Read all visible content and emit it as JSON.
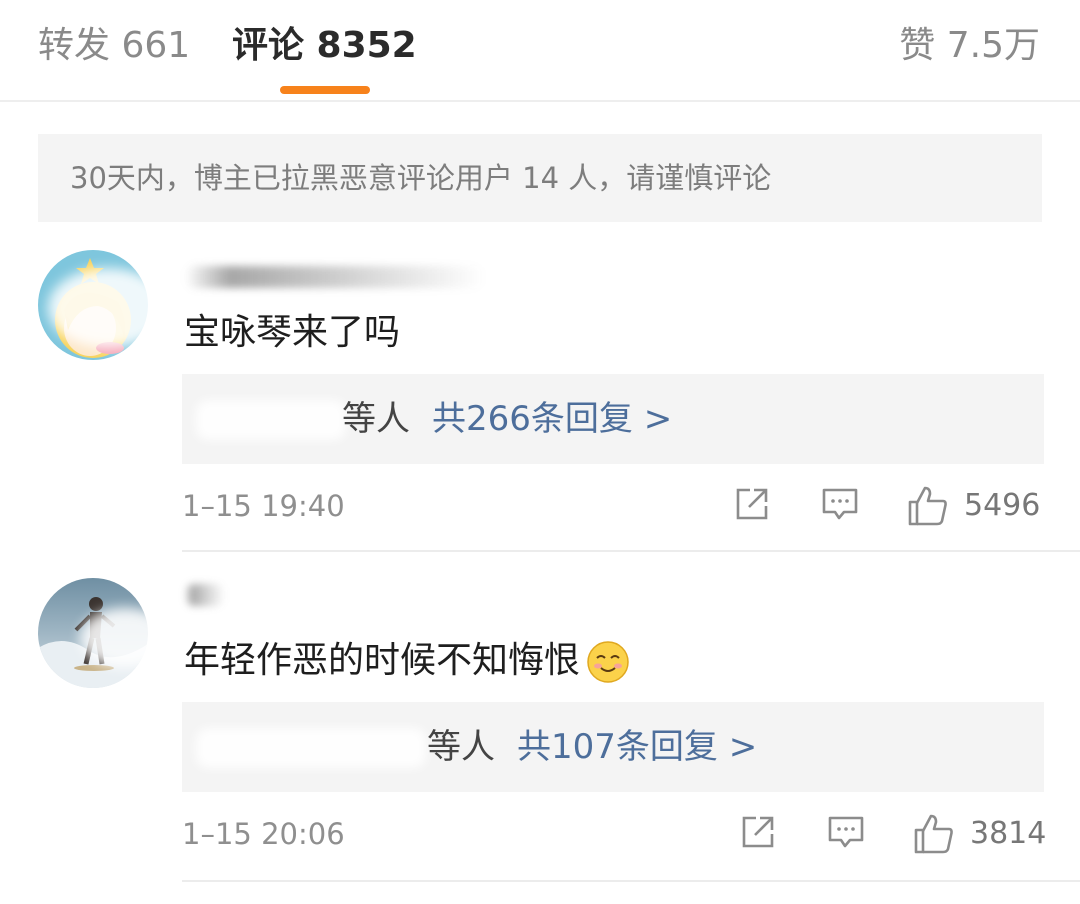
{
  "tabs": {
    "repost": "转发 661",
    "comment": "评论 8352",
    "like": "赞 7.5万"
  },
  "accent_color": "#f7821b",
  "notice": "30天内，博主已拉黑恶意评论用户 14 人，请谨慎评论",
  "comments": [
    {
      "text": "宝咏琴来了吗",
      "reply_names": "等人",
      "reply_link": "共266条回复 >",
      "timestamp": "1–15 19:40",
      "likes": "5496"
    },
    {
      "text": "年轻作恶的时候不知悔恨",
      "emoji": "smile-emoji",
      "reply_names": "等人",
      "reply_link": "共107条回复 >",
      "timestamp": "1–15 20:06",
      "likes": "3814"
    }
  ],
  "link_color": "#4d6e9b",
  "icons": [
    "share-icon",
    "comment-icon",
    "thumbs-up-icon"
  ]
}
